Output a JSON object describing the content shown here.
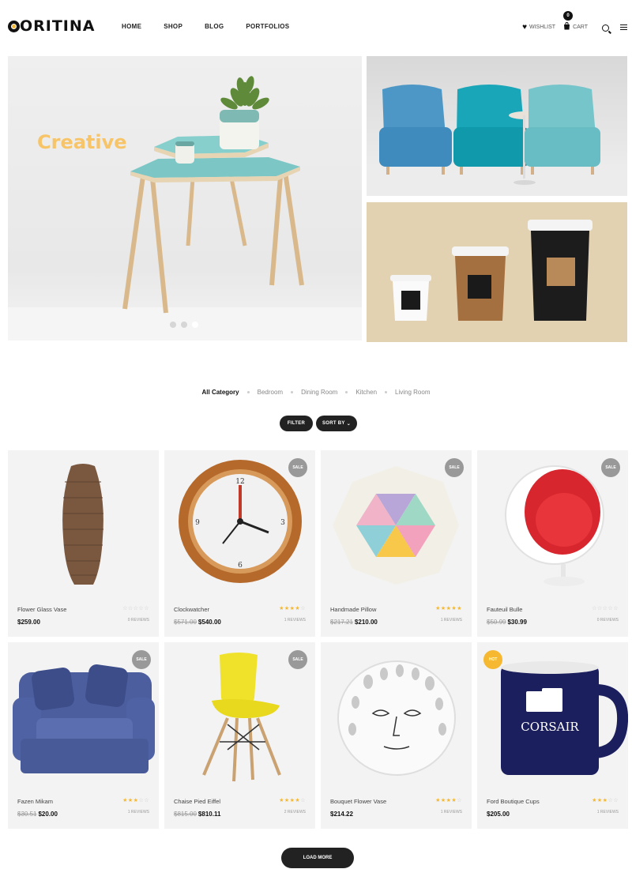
{
  "header": {
    "logo": "ORITINA",
    "nav": [
      "HOME",
      "SHOP",
      "BLOG",
      "PORTFOLIOS"
    ],
    "wishlist_label": "WISHLIST",
    "cart_label": "CART",
    "cart_count": "0"
  },
  "hero": {
    "title": "Creative",
    "slides": 3,
    "active_slide": 3
  },
  "filters": {
    "categories": [
      "All Category",
      "Bedroom",
      "Dining Room",
      "Kitchen",
      "Living Room"
    ],
    "active_category": "All Category",
    "filter_label": "FILTER",
    "sort_label": "SORT BY"
  },
  "products": [
    {
      "name": "Flower Glass Vase",
      "price": "$259.00",
      "old_price": "",
      "badge": "",
      "rating": 0,
      "reviews": "0 REVIEWS"
    },
    {
      "name": "Clockwatcher",
      "price": "$540.00",
      "old_price": "$571.00",
      "badge": "SALE",
      "rating": 4,
      "reviews": "1 REVIEWS"
    },
    {
      "name": "Handmade Pillow",
      "price": "$210.00",
      "old_price": "$217.21",
      "badge": "SALE",
      "rating": 5,
      "reviews": "1 REVIEWS"
    },
    {
      "name": "Fauteuil Bulle",
      "price": "$30.99",
      "old_price": "$50.99",
      "badge": "SALE",
      "rating": 0,
      "reviews": "0 REVIEWS"
    },
    {
      "name": "Fazen Mikam",
      "price": "$20.00",
      "old_price": "$30.51",
      "badge": "SALE",
      "rating": 3,
      "reviews": "1 REVIEWS"
    },
    {
      "name": "Chaise Pied Eiffel",
      "price": "$810.11",
      "old_price": "$815.00",
      "badge": "SALE",
      "rating": 4,
      "reviews": "2 REVIEWS"
    },
    {
      "name": "Bouquet Flower Vase",
      "price": "$214.22",
      "old_price": "",
      "badge": "",
      "rating": 4,
      "reviews": "1 REVIEWS"
    },
    {
      "name": "Ford Boutique Cups",
      "price": "$205.00",
      "old_price": "",
      "badge": "HOT",
      "rating": 3,
      "reviews": "1 REVIEWS"
    }
  ],
  "load_more_label": "LOAD MORE",
  "colors": {
    "accent": "#f5b830",
    "dark": "#222222",
    "card_bg": "#f3f3f3"
  }
}
